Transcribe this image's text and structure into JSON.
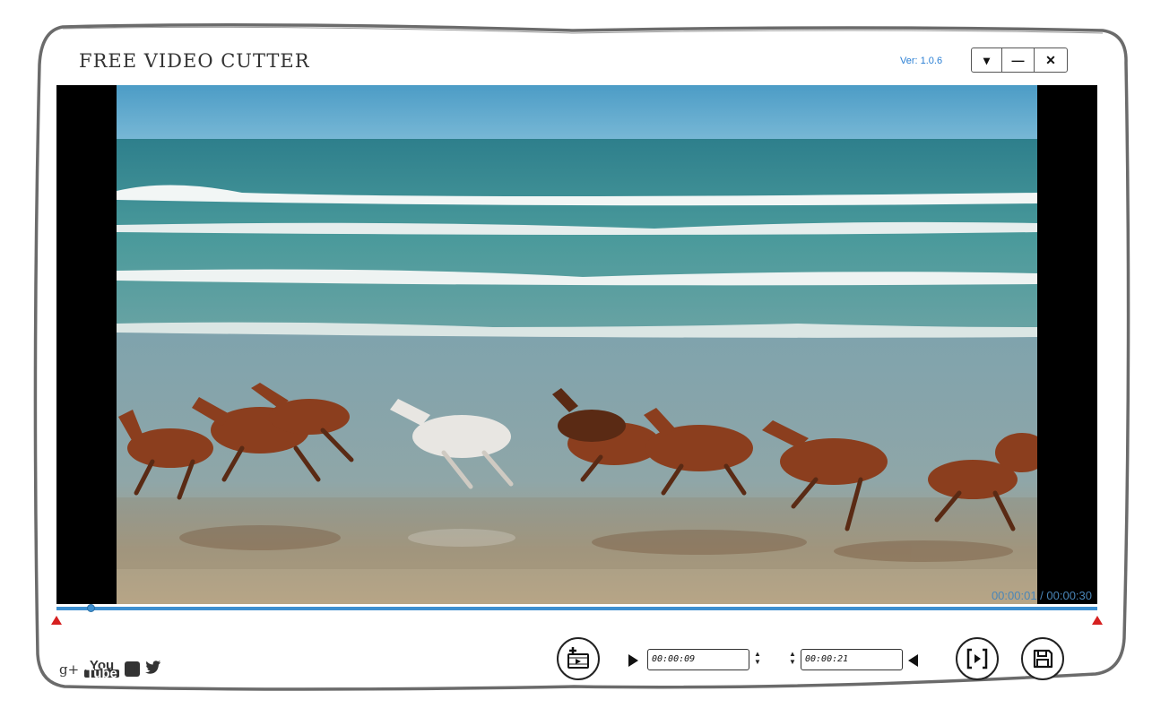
{
  "app": {
    "title": "FREE VIDEO CUTTER",
    "version": "Ver: 1.0.6"
  },
  "window_controls": {
    "menu_glyph": "▾",
    "minimize_glyph": "—",
    "close_glyph": "✕"
  },
  "player": {
    "time_display": "00:00:01 / 00:00:30",
    "current_time": "00:00:01",
    "total_time": "00:00:30",
    "progress_fraction": 0.033
  },
  "cut": {
    "start_time": "00:00:09",
    "end_time": "00:00:21"
  },
  "icons": {
    "add_clip": "add-video-icon",
    "mark_start": "play-right-icon",
    "mark_end": "play-left-icon",
    "cut": "trim-icon",
    "save": "floppy-disk-icon"
  },
  "social": {
    "google_plus": "g+",
    "youtube_top": "You",
    "youtube_bottom": "Tube",
    "facebook": "f"
  },
  "colors": {
    "accent": "#3d8fd0",
    "marker": "#d62020",
    "version_text": "#2a7fd4",
    "time_text": "#4a86b8"
  }
}
